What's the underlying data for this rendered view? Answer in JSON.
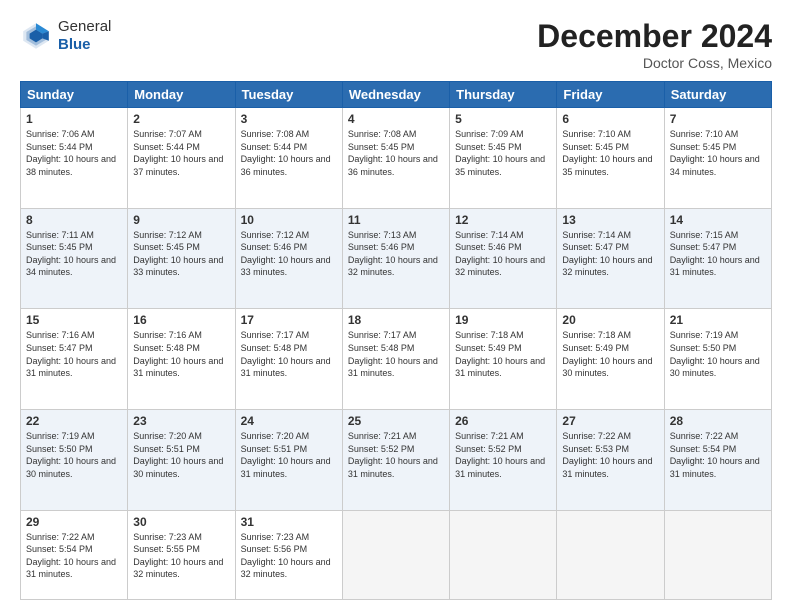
{
  "header": {
    "logo": {
      "general": "General",
      "blue": "Blue"
    },
    "title": "December 2024",
    "location": "Doctor Coss, Mexico"
  },
  "days_of_week": [
    "Sunday",
    "Monday",
    "Tuesday",
    "Wednesday",
    "Thursday",
    "Friday",
    "Saturday"
  ],
  "weeks": [
    [
      {
        "day": "1",
        "sunrise": "7:06 AM",
        "sunset": "5:44 PM",
        "daylight": "10 hours and 38 minutes."
      },
      {
        "day": "2",
        "sunrise": "7:07 AM",
        "sunset": "5:44 PM",
        "daylight": "10 hours and 37 minutes."
      },
      {
        "day": "3",
        "sunrise": "7:08 AM",
        "sunset": "5:44 PM",
        "daylight": "10 hours and 36 minutes."
      },
      {
        "day": "4",
        "sunrise": "7:08 AM",
        "sunset": "5:45 PM",
        "daylight": "10 hours and 36 minutes."
      },
      {
        "day": "5",
        "sunrise": "7:09 AM",
        "sunset": "5:45 PM",
        "daylight": "10 hours and 35 minutes."
      },
      {
        "day": "6",
        "sunrise": "7:10 AM",
        "sunset": "5:45 PM",
        "daylight": "10 hours and 35 minutes."
      },
      {
        "day": "7",
        "sunrise": "7:10 AM",
        "sunset": "5:45 PM",
        "daylight": "10 hours and 34 minutes."
      }
    ],
    [
      {
        "day": "8",
        "sunrise": "7:11 AM",
        "sunset": "5:45 PM",
        "daylight": "10 hours and 34 minutes."
      },
      {
        "day": "9",
        "sunrise": "7:12 AM",
        "sunset": "5:45 PM",
        "daylight": "10 hours and 33 minutes."
      },
      {
        "day": "10",
        "sunrise": "7:12 AM",
        "sunset": "5:46 PM",
        "daylight": "10 hours and 33 minutes."
      },
      {
        "day": "11",
        "sunrise": "7:13 AM",
        "sunset": "5:46 PM",
        "daylight": "10 hours and 32 minutes."
      },
      {
        "day": "12",
        "sunrise": "7:14 AM",
        "sunset": "5:46 PM",
        "daylight": "10 hours and 32 minutes."
      },
      {
        "day": "13",
        "sunrise": "7:14 AM",
        "sunset": "5:47 PM",
        "daylight": "10 hours and 32 minutes."
      },
      {
        "day": "14",
        "sunrise": "7:15 AM",
        "sunset": "5:47 PM",
        "daylight": "10 hours and 31 minutes."
      }
    ],
    [
      {
        "day": "15",
        "sunrise": "7:16 AM",
        "sunset": "5:47 PM",
        "daylight": "10 hours and 31 minutes."
      },
      {
        "day": "16",
        "sunrise": "7:16 AM",
        "sunset": "5:48 PM",
        "daylight": "10 hours and 31 minutes."
      },
      {
        "day": "17",
        "sunrise": "7:17 AM",
        "sunset": "5:48 PM",
        "daylight": "10 hours and 31 minutes."
      },
      {
        "day": "18",
        "sunrise": "7:17 AM",
        "sunset": "5:48 PM",
        "daylight": "10 hours and 31 minutes."
      },
      {
        "day": "19",
        "sunrise": "7:18 AM",
        "sunset": "5:49 PM",
        "daylight": "10 hours and 31 minutes."
      },
      {
        "day": "20",
        "sunrise": "7:18 AM",
        "sunset": "5:49 PM",
        "daylight": "10 hours and 30 minutes."
      },
      {
        "day": "21",
        "sunrise": "7:19 AM",
        "sunset": "5:50 PM",
        "daylight": "10 hours and 30 minutes."
      }
    ],
    [
      {
        "day": "22",
        "sunrise": "7:19 AM",
        "sunset": "5:50 PM",
        "daylight": "10 hours and 30 minutes."
      },
      {
        "day": "23",
        "sunrise": "7:20 AM",
        "sunset": "5:51 PM",
        "daylight": "10 hours and 30 minutes."
      },
      {
        "day": "24",
        "sunrise": "7:20 AM",
        "sunset": "5:51 PM",
        "daylight": "10 hours and 31 minutes."
      },
      {
        "day": "25",
        "sunrise": "7:21 AM",
        "sunset": "5:52 PM",
        "daylight": "10 hours and 31 minutes."
      },
      {
        "day": "26",
        "sunrise": "7:21 AM",
        "sunset": "5:52 PM",
        "daylight": "10 hours and 31 minutes."
      },
      {
        "day": "27",
        "sunrise": "7:22 AM",
        "sunset": "5:53 PM",
        "daylight": "10 hours and 31 minutes."
      },
      {
        "day": "28",
        "sunrise": "7:22 AM",
        "sunset": "5:54 PM",
        "daylight": "10 hours and 31 minutes."
      }
    ],
    [
      {
        "day": "29",
        "sunrise": "7:22 AM",
        "sunset": "5:54 PM",
        "daylight": "10 hours and 31 minutes."
      },
      {
        "day": "30",
        "sunrise": "7:23 AM",
        "sunset": "5:55 PM",
        "daylight": "10 hours and 32 minutes."
      },
      {
        "day": "31",
        "sunrise": "7:23 AM",
        "sunset": "5:56 PM",
        "daylight": "10 hours and 32 minutes."
      },
      null,
      null,
      null,
      null
    ]
  ]
}
